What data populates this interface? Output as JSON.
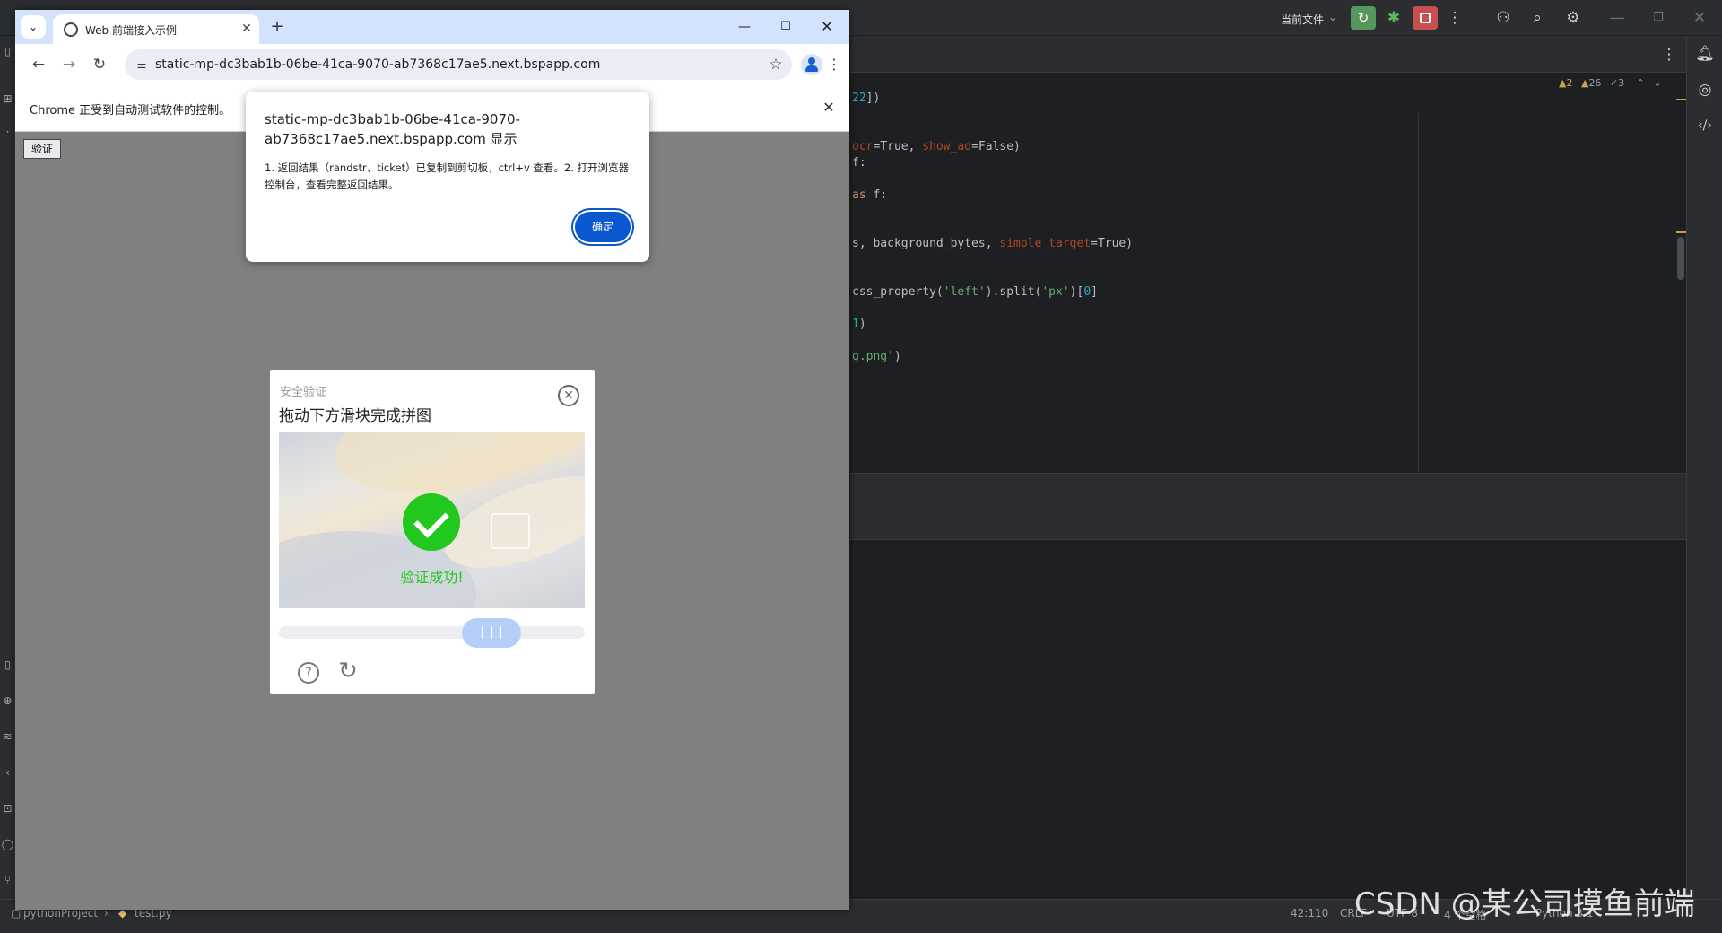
{
  "browser": {
    "tab_title": "Web 前端接入示例",
    "url": "static-mp-dc3bab1b-06be-41ca-9070-ab7368c17ae5.next.bspapp.com",
    "infobar_text": "Chrome 正受到自动测试软件的控制。"
  },
  "page": {
    "verify_button": "验证"
  },
  "captcha": {
    "subtitle": "安全验证",
    "title": "拖动下方滑块完成拼图",
    "success_text": "验证成功!",
    "slider_position_fraction": 0.74
  },
  "alert": {
    "title": "static-mp-dc3bab1b-06be-41ca-9070-ab7368c17ae5.next.bspapp.com 显示",
    "message": "1. 返回结果（randstr、ticket）已复制到剪切板，ctrl+v 查看。2. 打开浏览器控制台，查看完整返回结果。",
    "ok_button": "确定"
  },
  "ide": {
    "top_file_selector": "当前文件",
    "inspections": {
      "warnings": "2",
      "weak_warnings": "26",
      "ok": "3"
    },
    "code_lines": [
      {
        "segments": [
          {
            "t": "22",
            "c": "nm"
          },
          {
            "t": "])",
            "c": ""
          }
        ]
      },
      {
        "segments": [
          {
            "t": "ocr",
            "c": "pm"
          },
          {
            "t": "=True, ",
            "c": ""
          },
          {
            "t": "show_ad",
            "c": "pm"
          },
          {
            "t": "=False)",
            "c": ""
          }
        ]
      },
      {
        "segments": [
          {
            "t": "f:",
            "c": ""
          }
        ]
      },
      {
        "segments": [
          {
            "t": "as",
            "c": "kw"
          },
          {
            "t": " f:",
            "c": ""
          }
        ]
      },
      {
        "segments": [
          {
            "t": "s, background_bytes, ",
            "c": ""
          },
          {
            "t": "simple_target",
            "c": "pm"
          },
          {
            "t": "=True)",
            "c": ""
          }
        ]
      },
      {
        "segments": [
          {
            "t": "css_property(",
            "c": ""
          },
          {
            "t": "'left'",
            "c": "st"
          },
          {
            "t": ").split(",
            "c": ""
          },
          {
            "t": "'px'",
            "c": "st"
          },
          {
            "t": ")[",
            "c": ""
          },
          {
            "t": "0",
            "c": "nm"
          },
          {
            "t": "]",
            "c": ""
          }
        ]
      },
      {
        "segments": [
          {
            "t": "1",
            "c": "nm"
          },
          {
            "t": ")",
            "c": ""
          }
        ]
      },
      {
        "segments": [
          {
            "t": "g.png'",
            "c": "st"
          },
          {
            "t": ")",
            "c": ""
          }
        ]
      }
    ],
    "status": {
      "project": "pythonProject",
      "file": "test.py",
      "position": "42:110",
      "line_ending": "CRLF",
      "encoding": "UTF-8",
      "indent": "4 个空格",
      "interpreter": "Python 3.1"
    },
    "watermark": "CSDN @某公司摸鱼前端"
  },
  "colors": {
    "accent_blue": "#0b57d0",
    "success_green": "#22c81e",
    "ide_bg": "#1e1f22"
  }
}
